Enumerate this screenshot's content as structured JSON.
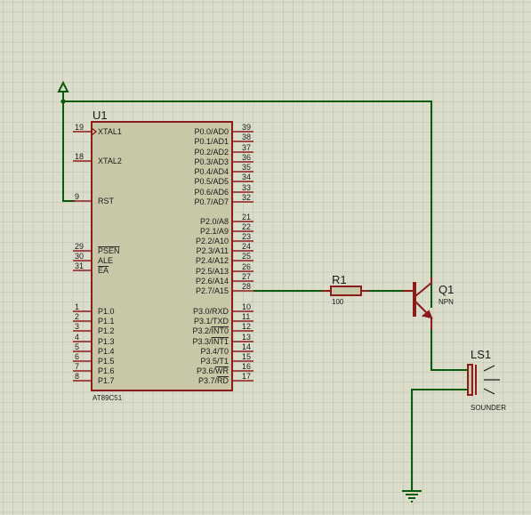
{
  "colors": {
    "background": "#dcdccb",
    "grid": "#bdbdae",
    "wire": "#0b5a0b",
    "component": "#8b1c1c",
    "chip_body": "#c8c8a8",
    "text": "#1a1a1a"
  },
  "u1": {
    "ref": "U1",
    "part": "AT89C51",
    "left_pins": [
      {
        "num": "19",
        "label": "XTAL1",
        "overline": false,
        "clock": true
      },
      {
        "num": "18",
        "label": "XTAL2",
        "overline": false
      },
      {
        "num": "9",
        "label": "RST",
        "overline": false
      },
      {
        "num": "29",
        "label": "PSEN",
        "overline": true
      },
      {
        "num": "30",
        "label": "ALE",
        "overline": false
      },
      {
        "num": "31",
        "label": "EA",
        "overline": true
      },
      {
        "num": "1",
        "label": "P1.0"
      },
      {
        "num": "2",
        "label": "P1.1"
      },
      {
        "num": "3",
        "label": "P1.2"
      },
      {
        "num": "4",
        "label": "P1.3"
      },
      {
        "num": "5",
        "label": "P1.4"
      },
      {
        "num": "6",
        "label": "P1.5"
      },
      {
        "num": "7",
        "label": "P1.6"
      },
      {
        "num": "8",
        "label": "P1.7"
      }
    ],
    "right_pins": [
      {
        "num": "39",
        "label": "P0.0/AD0"
      },
      {
        "num": "38",
        "label": "P0.1/AD1"
      },
      {
        "num": "37",
        "label": "P0.2/AD2"
      },
      {
        "num": "36",
        "label": "P0.3/AD3"
      },
      {
        "num": "35",
        "label": "P0.4/AD4"
      },
      {
        "num": "34",
        "label": "P0.5/AD5"
      },
      {
        "num": "33",
        "label": "P0.6/AD6"
      },
      {
        "num": "32",
        "label": "P0.7/AD7"
      },
      {
        "num": "21",
        "label": "P2.0/A8"
      },
      {
        "num": "22",
        "label": "P2.1/A9"
      },
      {
        "num": "23",
        "label": "P2.2/A10"
      },
      {
        "num": "24",
        "label": "P2.3/A11"
      },
      {
        "num": "25",
        "label": "P2.4/A12"
      },
      {
        "num": "26",
        "label": "P2.5/A13"
      },
      {
        "num": "27",
        "label": "P2.6/A14"
      },
      {
        "num": "28",
        "label": "P2.7/A15"
      },
      {
        "num": "10",
        "label": "P3.0/RXD"
      },
      {
        "num": "11",
        "label": "P3.1/TXD"
      },
      {
        "num": "12",
        "label": "P3.2/",
        "over": "INT0"
      },
      {
        "num": "13",
        "label": "P3.3/",
        "over": "INT1"
      },
      {
        "num": "14",
        "label": "P3.4/T0"
      },
      {
        "num": "15",
        "label": "P3.5/T1"
      },
      {
        "num": "16",
        "label": "P3.6/",
        "over": "WR"
      },
      {
        "num": "17",
        "label": "P3.7/",
        "over": "RD"
      }
    ]
  },
  "r1": {
    "ref": "R1",
    "value": "100"
  },
  "q1": {
    "ref": "Q1",
    "type": "NPN"
  },
  "ls1": {
    "ref": "LS1",
    "type": "SOUNDER"
  }
}
